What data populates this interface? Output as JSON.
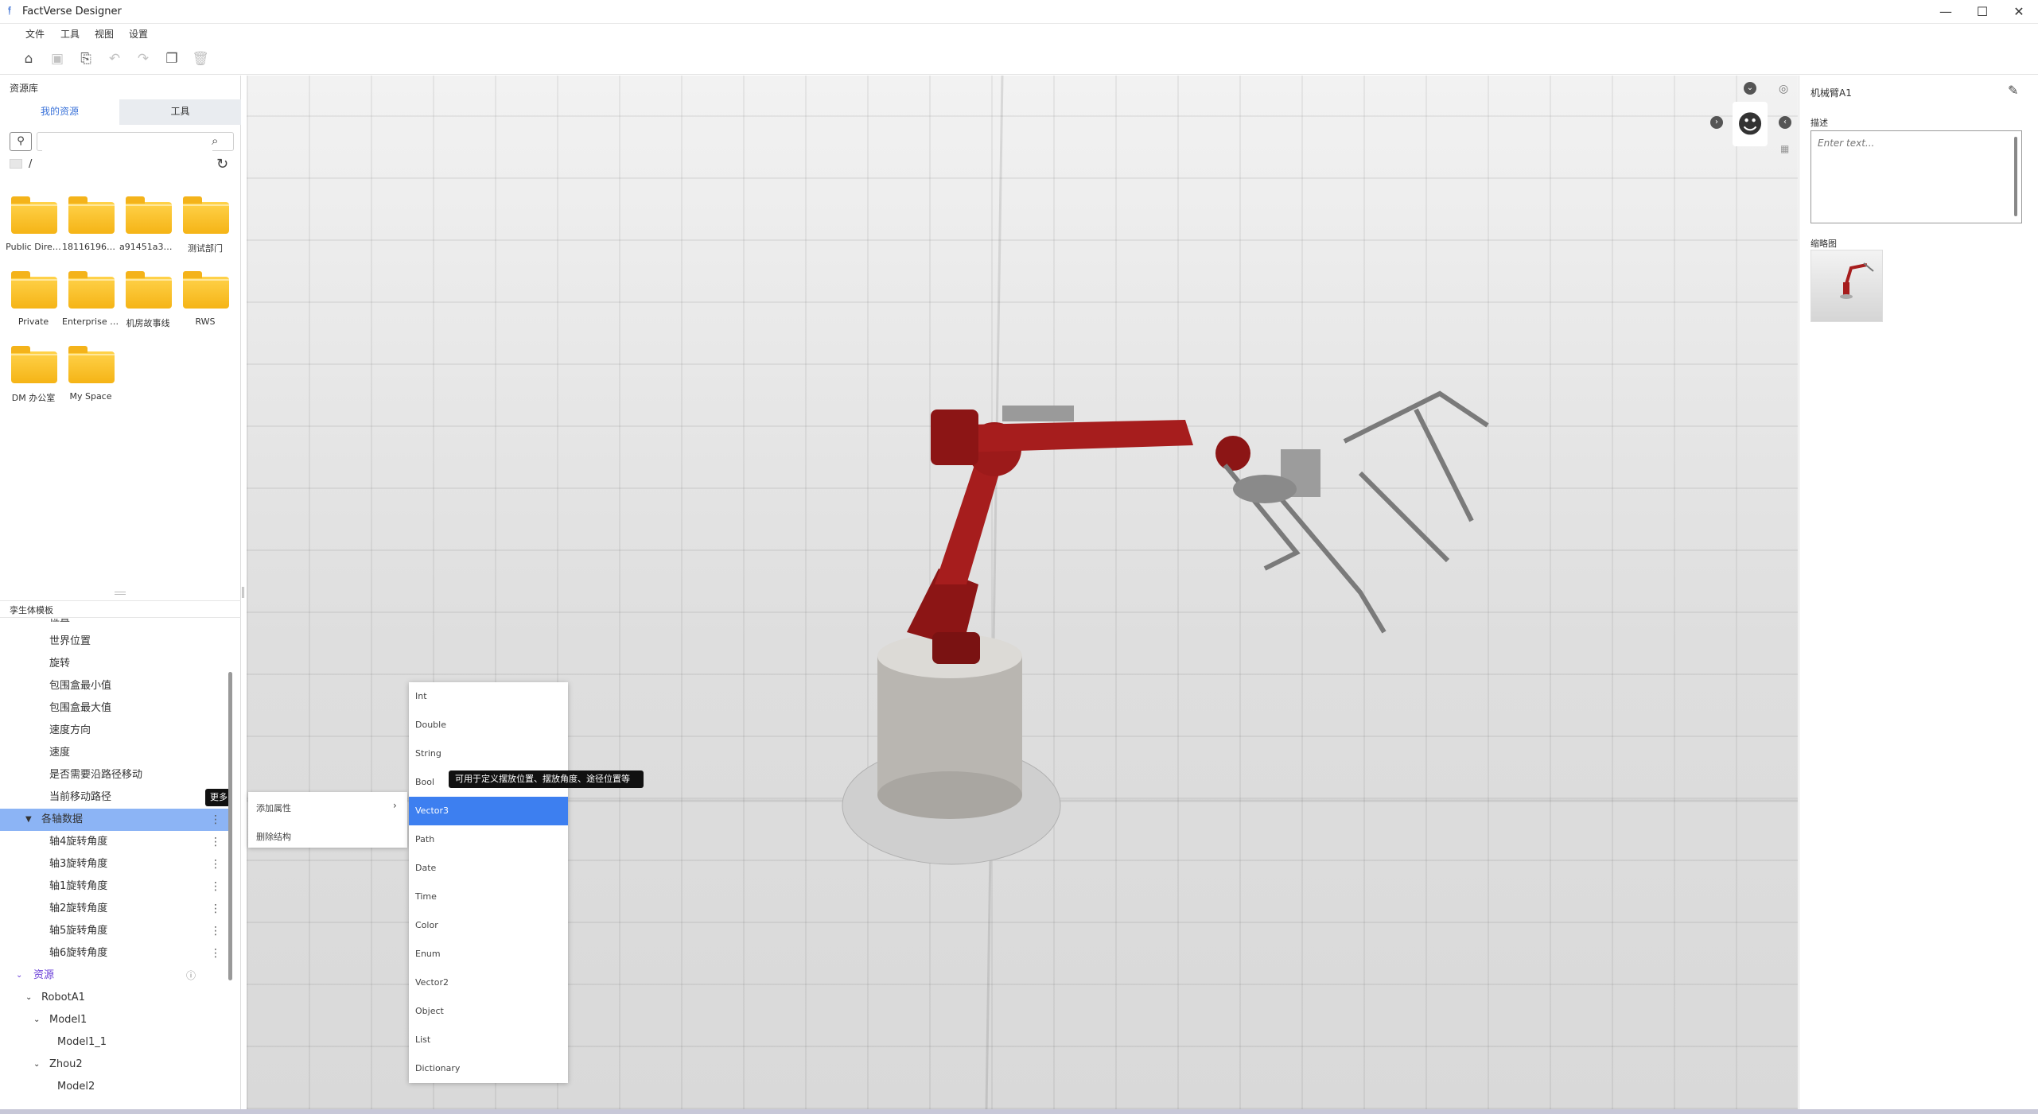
{
  "app": {
    "title": "FactVerse Designer",
    "logo_glyph": "𝔣",
    "window_controls": [
      "—",
      "☐",
      "✕"
    ]
  },
  "menu": [
    "文件",
    "工具",
    "视图",
    "设置"
  ],
  "toolbar": {
    "icons": [
      "home-icon",
      "save-icon",
      "save-as-icon",
      "undo-icon",
      "redo-icon",
      "copy-icon",
      "delete-icon"
    ]
  },
  "resource_library": {
    "header": "资源库",
    "tabs": [
      "我的资源",
      "工具"
    ],
    "search_placeholder": "",
    "path": "/",
    "folders": [
      "Public Dire…",
      "181161965…",
      "a91451a34…",
      "测试部门",
      "Private",
      "Enterprise s…",
      "机房故事线",
      "RWS",
      "DM 办公室",
      "My Space"
    ]
  },
  "twin_template": {
    "header": "孪生体模板",
    "partial_item": "位置",
    "items": [
      {
        "label": "世界位置"
      },
      {
        "label": "旋转"
      },
      {
        "label": "包围盒最小值"
      },
      {
        "label": "包围盒最大值"
      },
      {
        "label": "速度方向"
      },
      {
        "label": "速度"
      },
      {
        "label": "是否需要沿路径移动"
      },
      {
        "label": "当前移动路径"
      }
    ],
    "selected_group": "各轴数据",
    "more_tooltip": "更多",
    "group_children": [
      "轴4旋转角度",
      "轴3旋转角度",
      "轴1旋转角度",
      "轴2旋转角度",
      "轴5旋转角度",
      "轴6旋转角度"
    ],
    "resources_label": "资源",
    "resources_tree": [
      "RobotA1",
      "Model1",
      "Model1_1",
      "Zhou2",
      "Model2"
    ]
  },
  "context_menu": {
    "items": [
      "添加属性",
      "删除结构"
    ],
    "submenu": [
      "Int",
      "Double",
      "String",
      "Bool",
      "Vector3",
      "Path",
      "Date",
      "Time",
      "Color",
      "Enum",
      "Vector2",
      "Object",
      "List",
      "Dictionary"
    ],
    "active": "Vector3",
    "tooltip": "可用于定义摆放位置、摆放角度、途径位置等"
  },
  "properties": {
    "object_name": "机械臂A1",
    "description_label": "描述",
    "description_placeholder": "Enter text...",
    "thumbnail_label": "缩略图"
  },
  "colors": {
    "accent": "#3d7ff0",
    "selected_row": "#8cb4f5",
    "folder": "#f5b416",
    "robot": "#a61d1d"
  }
}
